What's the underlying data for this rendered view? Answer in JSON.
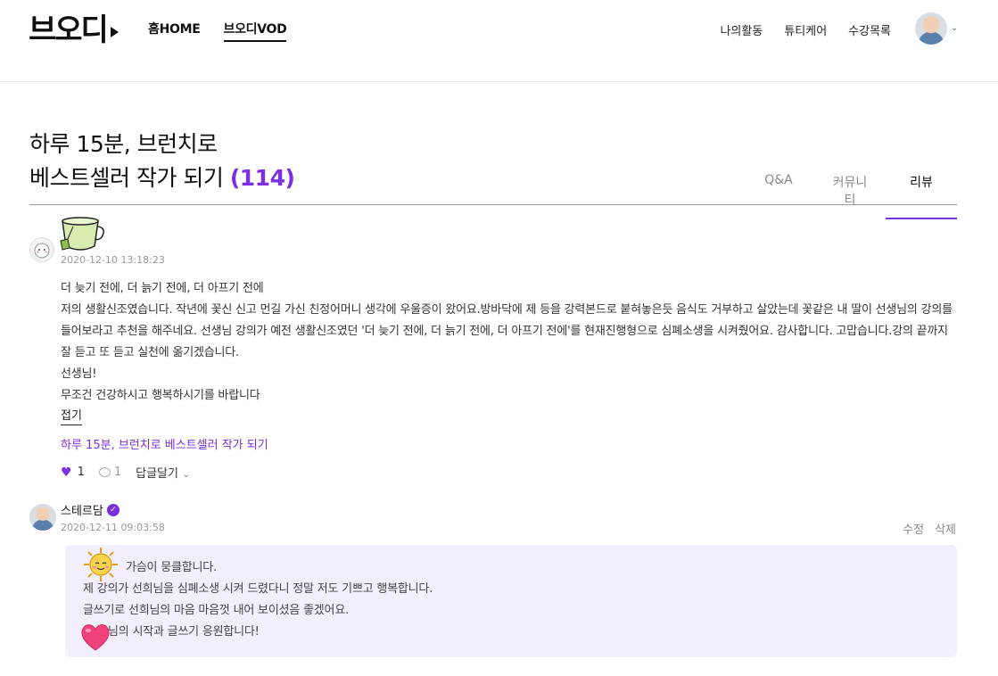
{
  "header": {
    "logo": "브오디",
    "nav_left": [
      "홈HOME",
      "브오디VOD"
    ],
    "nav_right": [
      "나의활동",
      "튜티케어",
      "수강목록"
    ]
  },
  "title": {
    "line1": "하루 15분, 브런치로",
    "line2": "베스트셀러 작가 되기",
    "count": "(114)"
  },
  "tabs": [
    "Q&A",
    "커뮤니티",
    "리뷰"
  ],
  "review": {
    "date": "2020-12-10 13:18:23",
    "lines": [
      "더 늦기 전에, 더 늙기 전에, 더 아프기 전에",
      "저의 생활신조였습니다. 작년에 꽃신 신고 먼길 가신 친정어머니 생각에 우울증이 왔어요.방바닥에 제 등을 강력본드로 붙혀놓은듯 음식도 거부하고 살았는데 꽃같은 내 딸이 선생님의 강의를 들어보라고 추천을 해주네요. 선생님 강의가 예전 생활신조였던 '더 늦기 전에, 더 늙기 전에, 더 아프기 전에'를 현재진행형으로 심폐소생을 시켜줬어요. 감사합니다. 고맙습니다.강의 끝까지 잘 듣고 또 듣고 실천에 옮기겠습니다.",
      "선생님!",
      "무조건 건강하시고 행복하시기를 바랍니다"
    ],
    "fold": "접기",
    "course_link": "하루 15분, 브런치로 베스트셀러 작가 되기",
    "likes": "1",
    "comments": "1",
    "reply": "답글달기"
  },
  "comment": {
    "author": "스테르담",
    "date": "2020-12-11 09:03:58",
    "edit": "수정",
    "delete": "삭제",
    "lines": [
      "가슴이 뭉클합니다.",
      "제 강의가 선희님을 심폐소생 시켜 드렸다니 정말 저도 기쁘고 행복합니다.",
      "글쓰기로 선희님의 마음 마음껏 내어 보이셨음 좋겠어요.",
      "님의 시작과 글쓰기 응원합니다!"
    ]
  },
  "colors": {
    "accent": "#7b2fe0",
    "comment_bg": "#f3eefb"
  }
}
